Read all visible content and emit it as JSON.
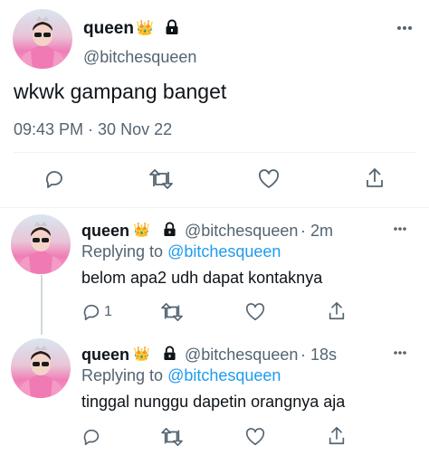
{
  "main_tweet": {
    "display_name": "queen",
    "crown_emoji": "👑",
    "handle": "@bitchesqueen",
    "text": "wkwk gampang banget",
    "timestamp": "09:43 PM · 30 Nov 22"
  },
  "replies": [
    {
      "display_name": "queen",
      "crown_emoji": "👑",
      "handle": "@bitchesqueen",
      "age": "· 2m",
      "replying_prefix": "Replying to",
      "replying_to": "@bitchesqueen",
      "text": "belom apa2 udh dapat kontaknya",
      "reply_count": "1"
    },
    {
      "display_name": "queen",
      "crown_emoji": "👑",
      "handle": "@bitchesqueen",
      "age": "· 18s",
      "replying_prefix": "Replying to",
      "replying_to": "@bitchesqueen",
      "text": "tinggal nunggu dapetin orangnya aja",
      "reply_count": ""
    }
  ],
  "colors": {
    "text": "#0f1419",
    "secondary": "#536471",
    "accent": "#1d9bf0",
    "divider": "#eff3f4"
  }
}
